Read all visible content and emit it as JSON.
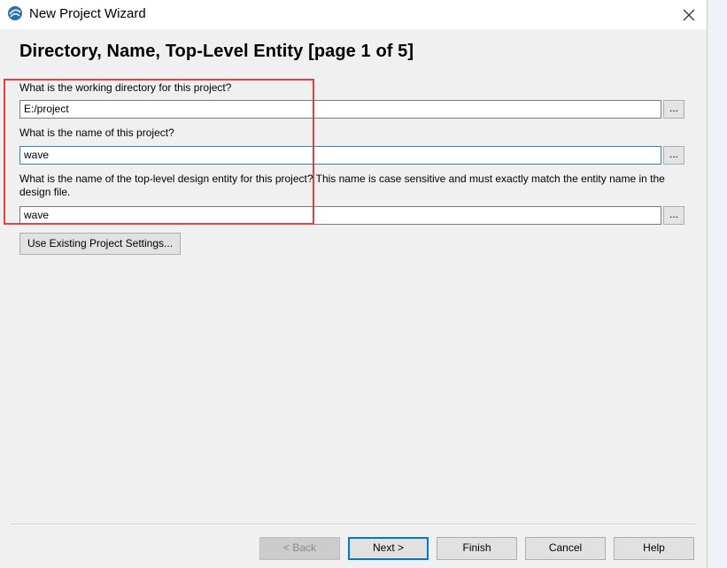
{
  "window": {
    "title": "New Project Wizard"
  },
  "page": {
    "heading": "Directory, Name, Top-Level Entity [page 1 of 5]"
  },
  "form": {
    "directory_label": "What is the working directory for this project?",
    "directory_value": "E:/project",
    "name_label": "What is the name of this project?",
    "name_value": "wave",
    "entity_label": "What is the name of the top-level design entity for this project? This name is case sensitive and must exactly match the entity name in the design file.",
    "entity_value": "wave",
    "browse_label": "...",
    "use_existing_label": "Use Existing Project Settings..."
  },
  "footer": {
    "back_label": "< Back",
    "next_label": "Next >",
    "finish_label": "Finish",
    "cancel_label": "Cancel",
    "help_label": "Help"
  },
  "colors": {
    "highlight_box": "#e8403f",
    "focus_border": "#3c7fb1",
    "default_button_border": "#0078d7"
  }
}
